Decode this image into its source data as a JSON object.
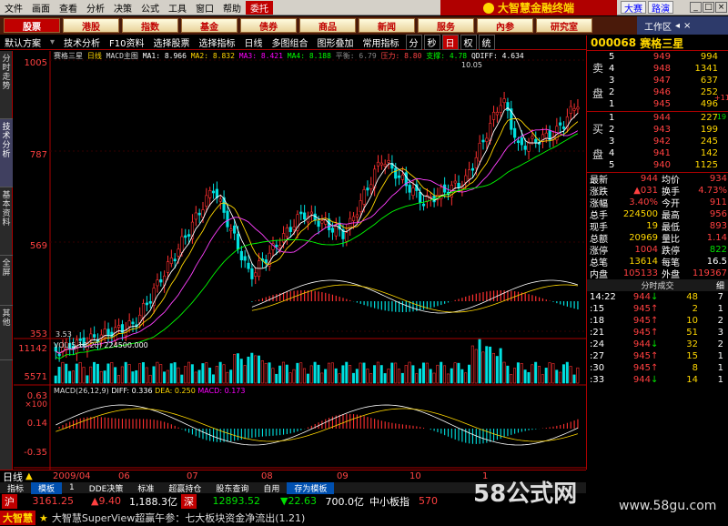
{
  "menu": {
    "items": [
      "文件",
      "画面",
      "查看",
      "分析",
      "决策",
      "公式",
      "工具",
      "窗口",
      "帮助"
    ],
    "entrust": "委托",
    "brand": "大智慧金融终端",
    "mini": [
      "大赛",
      "路演"
    ]
  },
  "tabs": [
    "股票",
    "港股",
    "指数",
    "基金",
    "债券",
    "商品",
    "新闻",
    "服务",
    "內参",
    "研究室"
  ],
  "workzone": "工作区",
  "toolbar": {
    "items": [
      "默认方案",
      "技术分析",
      "F10资料",
      "选择股票",
      "选择指标",
      "日线",
      "多图组合",
      "图形叠加",
      "常用指标"
    ],
    "periods": [
      "分",
      "秒",
      "日",
      "权",
      "统"
    ],
    "active_period": "日"
  },
  "sidebar": {
    "items": [
      "分时走势",
      "技术分析",
      "基本资料",
      "全屏",
      "其他"
    ],
    "active": "技术分析"
  },
  "chart_info": {
    "stock": "赛格三星",
    "period": "日线",
    "main": "MACD主图",
    "ma1": "MA1: 8.966",
    "ma2": "MA2: 8.832",
    "ma3": "MA3: 8.421",
    "ma4": "MA4: 8.188",
    "flat": "平衡: 6.79",
    "pressure": "压力: 8.80",
    "support": "支撑: 4.78",
    "qdiff": "QDIFF: 4.634",
    "high_label": "10.05",
    "low_label": "3.53",
    "vol_info": "VOL(5,10,20)",
    "vol_value": "224500.000",
    "macd_info": "MACD(26,12,9)",
    "diff": "DIFF: 0.336",
    "dea": "DEA: 0.250",
    "macd": "MACD: 0.173"
  },
  "y_axis": {
    "price": [
      "1005",
      "787",
      "569",
      "353"
    ],
    "vol": [
      "11142",
      "5571",
      "×100"
    ],
    "macd": [
      "0.63",
      "0.14",
      "-0.35"
    ]
  },
  "x_axis": {
    "labels": [
      "2009/04",
      "06",
      "07",
      "08",
      "09",
      "10",
      "1"
    ]
  },
  "stock_header": {
    "code": "000068",
    "name": "赛格三星"
  },
  "sell": [
    {
      "n": "5",
      "p": "949",
      "v": "994"
    },
    {
      "n": "4",
      "p": "948",
      "v": "1341"
    },
    {
      "n": "3",
      "p": "947",
      "v": "637"
    },
    {
      "n": "2",
      "p": "946",
      "v": "252"
    },
    {
      "n": "1",
      "p": "945",
      "v": "496"
    }
  ],
  "buy": [
    {
      "n": "1",
      "p": "944",
      "v": "227"
    },
    {
      "n": "2",
      "p": "943",
      "v": "199"
    },
    {
      "n": "3",
      "p": "942",
      "v": "245"
    },
    {
      "n": "4",
      "p": "941",
      "v": "142"
    },
    {
      "n": "5",
      "p": "940",
      "v": "1125"
    }
  ],
  "sell_label": [
    "卖",
    "盘"
  ],
  "buy_label": [
    "买",
    "盘"
  ],
  "sell_side_note": "+11",
  "buy_side_note": "-19",
  "quote": [
    {
      "k1": "最新",
      "v1": "944",
      "k2": "均价",
      "v2": "934"
    },
    {
      "k1": "涨跌",
      "v1": "▲031",
      "k2": "换手",
      "v2": "4.73%"
    },
    {
      "k1": "涨幅",
      "v1": "3.40%",
      "k2": "今开",
      "v2": "911"
    },
    {
      "k1": "总手",
      "v1": "224500",
      "k2": "最高",
      "v2": "956"
    },
    {
      "k1": "现手",
      "v1": "19",
      "k2": "最低",
      "v2": "893"
    },
    {
      "k1": "总额",
      "v1": "20969",
      "k2": "量比",
      "v2": "1.14"
    },
    {
      "k1": "涨停",
      "v1": "1004",
      "k2": "跌停",
      "v2": "822"
    },
    {
      "k1": "总笔",
      "v1": "13614",
      "k2": "每笔",
      "v2": "16.5"
    },
    {
      "k1": "内盘",
      "v1": "105133",
      "k2": "外盘",
      "v2": "119367"
    }
  ],
  "ticks_title": "分时成交",
  "ticks_tab": "细",
  "ticks": [
    {
      "t": "14:22",
      "p": "944",
      "v": "48",
      "n": "7"
    },
    {
      "t": ":15",
      "p": "945",
      "v": "2",
      "n": "1"
    },
    {
      "t": ":18",
      "p": "945",
      "v": "10",
      "n": "2"
    },
    {
      "t": ":21",
      "p": "945",
      "v": "51",
      "n": "3"
    },
    {
      "t": ":24",
      "p": "944",
      "v": "32",
      "n": "2"
    },
    {
      "t": ":27",
      "p": "945",
      "v": "15",
      "n": "1"
    },
    {
      "t": ":30",
      "p": "945",
      "v": "8",
      "n": "1"
    },
    {
      "t": ":33",
      "p": "944",
      "v": "14",
      "n": "1"
    }
  ],
  "bottom": {
    "period": "日线",
    "tabs": [
      "指标",
      "模板",
      "1",
      "DDE决策",
      "标准",
      "超赢持仓",
      "股东查询",
      "自用",
      "存为模板"
    ],
    "active_tab": "模板"
  },
  "index": {
    "sh": "沪",
    "sh_val": "3161.25",
    "sh_chg": "▲9.40",
    "sh_amt": "1,188.3亿",
    "sz": "深",
    "sz_val": "12893.52",
    "sz_chg": "▼22.63",
    "sz_amt": "700.0亿",
    "board": "中小板指",
    "board_val": "570"
  },
  "ticker": {
    "logo": "大智慧",
    "text": "大智慧SuperView超赢午参：七大板块资金净流出(1.21)"
  },
  "watermark": "58公式网",
  "watermark_url": "www.58gu.com"
}
